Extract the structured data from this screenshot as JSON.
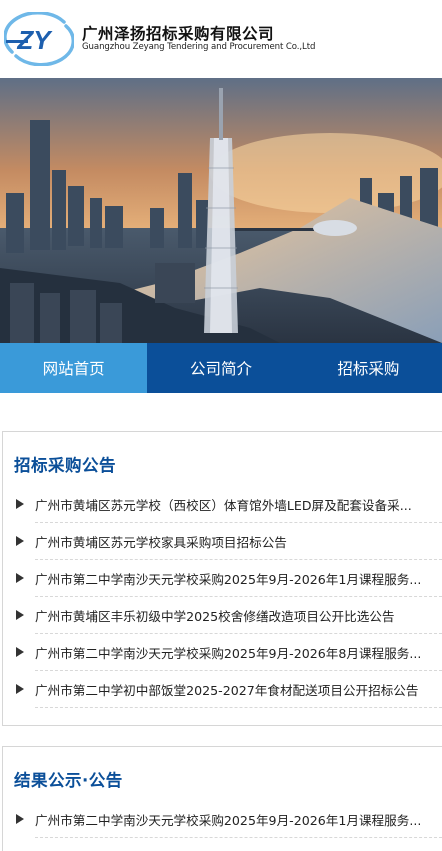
{
  "header": {
    "brand_cn": "广州泽扬招标采购有限公司",
    "brand_en": "Guangzhou Zeyang Tendering and Procurement Co.,Ltd",
    "logo_letters": "ZY"
  },
  "nav": {
    "items": [
      {
        "label": "网站首页",
        "active": true
      },
      {
        "label": "公司简介",
        "active": false
      },
      {
        "label": "招标采购",
        "active": false
      }
    ]
  },
  "sections": [
    {
      "title": "招标采购公告",
      "items": [
        "广州市黄埔区苏元学校（西校区）体育馆外墙LED屏及配套设备采...",
        "广州市黄埔区苏元学校家具采购项目招标公告",
        "广州市第二中学南沙天元学校采购2025年9月-2026年1月课程服务...",
        "广州市黄埔区丰乐初级中学2025校舍修缮改造项目公开比选公告",
        "广州市第二中学南沙天元学校采购2025年9月-2026年8月课程服务...",
        "广州市第二中学初中部饭堂2025-2027年食材配送项目公开招标公告"
      ]
    },
    {
      "title": "结果公示·公告",
      "items": [
        "广州市第二中学南沙天元学校采购2025年9月-2026年1月课程服务..."
      ]
    }
  ],
  "colors": {
    "nav_bg": "#0b4f99",
    "nav_active": "#3a9ad9",
    "title": "#0b4f99",
    "logo_blue": "#1d5fae"
  }
}
